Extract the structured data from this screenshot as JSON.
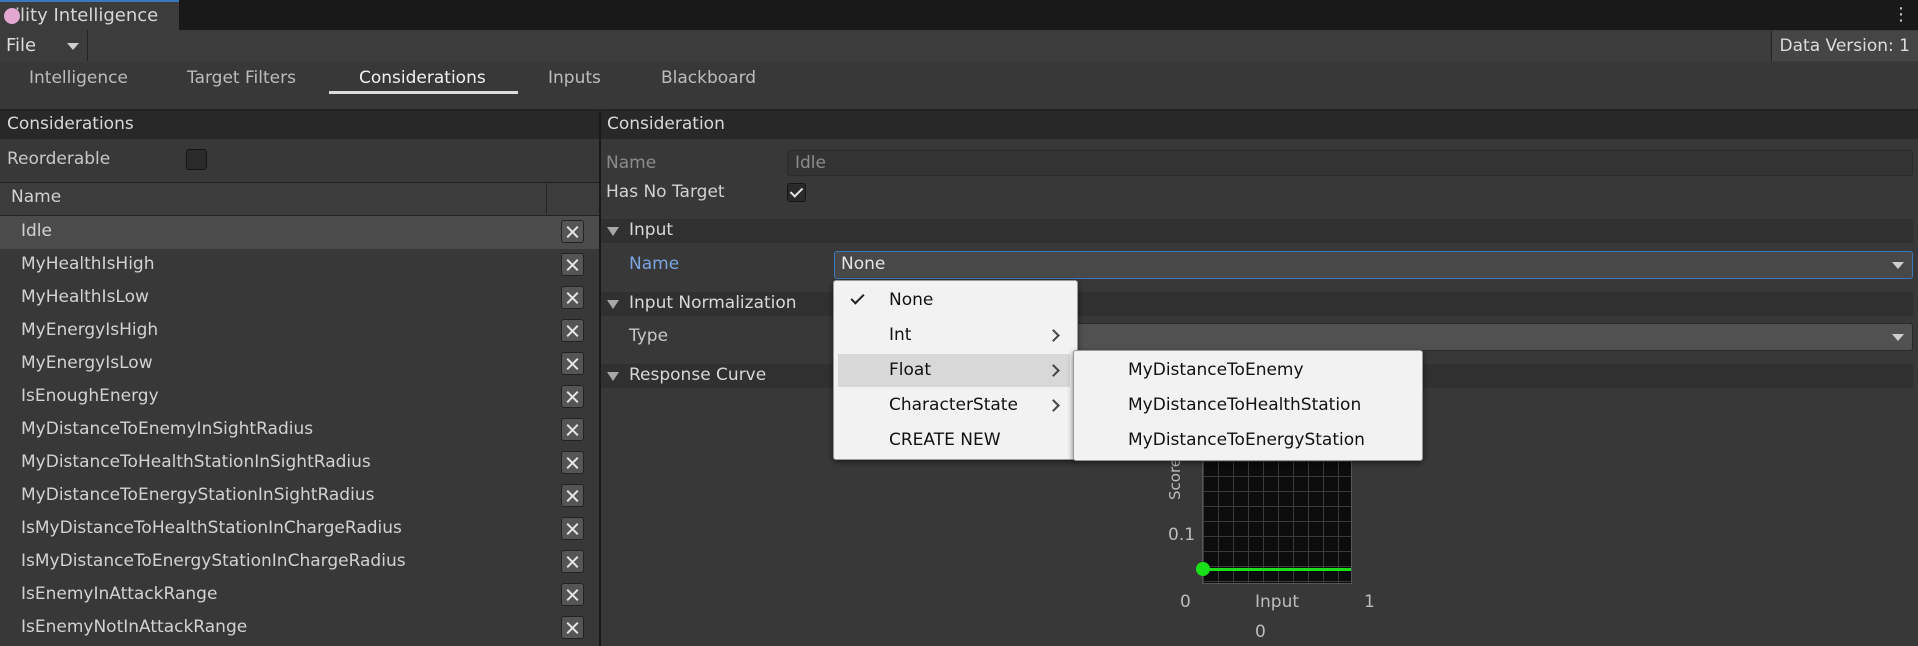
{
  "window": {
    "title": "tility Intelligence"
  },
  "menubar": {
    "file_label": "File",
    "data_version": "Data Version: 1"
  },
  "tabs": [
    {
      "label": "Intelligence"
    },
    {
      "label": "Target Filters"
    },
    {
      "label": "Considerations",
      "active": true
    },
    {
      "label": "Inputs"
    },
    {
      "label": "Blackboard"
    }
  ],
  "left": {
    "header": "Considerations",
    "reorderable_label": "Reorderable",
    "reorderable_checked": false,
    "column_name": "Name",
    "items": [
      {
        "label": "Idle",
        "selected": true
      },
      {
        "label": "MyHealthIsHigh"
      },
      {
        "label": "MyHealthIsLow"
      },
      {
        "label": "MyEnergyIsHigh"
      },
      {
        "label": "MyEnergyIsLow"
      },
      {
        "label": "IsEnoughEnergy"
      },
      {
        "label": "MyDistanceToEnemyInSightRadius"
      },
      {
        "label": "MyDistanceToHealthStationInSightRadius"
      },
      {
        "label": "MyDistanceToEnergyStationInSightRadius"
      },
      {
        "label": "IsMyDistanceToHealthStationInChargeRadius"
      },
      {
        "label": "IsMyDistanceToEnergyStationInChargeRadius"
      },
      {
        "label": "IsEnemyInAttackRange"
      },
      {
        "label": "IsEnemyNotInAttackRange"
      }
    ]
  },
  "right": {
    "header": "Consideration",
    "name_label": "Name",
    "name_value": "Idle",
    "has_no_target_label": "Has No Target",
    "has_no_target_checked": true,
    "input_section": "Input",
    "input_name_label": "Name",
    "input_name_value": "None",
    "normalization_section": "Input Normalization",
    "type_label": "Type",
    "curve_section": "Response Curve"
  },
  "curve": {
    "y_axis_label": "Score",
    "y_tick": "0.1",
    "x_tick_min": "0",
    "x_tick_max": "1",
    "x_axis_label": "Input",
    "x_sub_label": "0",
    "line_color": "#19e019"
  },
  "dropdown": {
    "items": [
      {
        "label": "None",
        "checked": true,
        "submenu": false
      },
      {
        "label": "Int",
        "submenu": true
      },
      {
        "label": "Float",
        "submenu": true,
        "highlighted": true
      },
      {
        "label": "CharacterState",
        "submenu": true
      },
      {
        "label": "CREATE NEW",
        "submenu": false
      }
    ],
    "float_submenu": [
      {
        "label": "MyDistanceToEnemy"
      },
      {
        "label": "MyDistanceToHealthStation"
      },
      {
        "label": "MyDistanceToEnergyStation"
      }
    ]
  }
}
